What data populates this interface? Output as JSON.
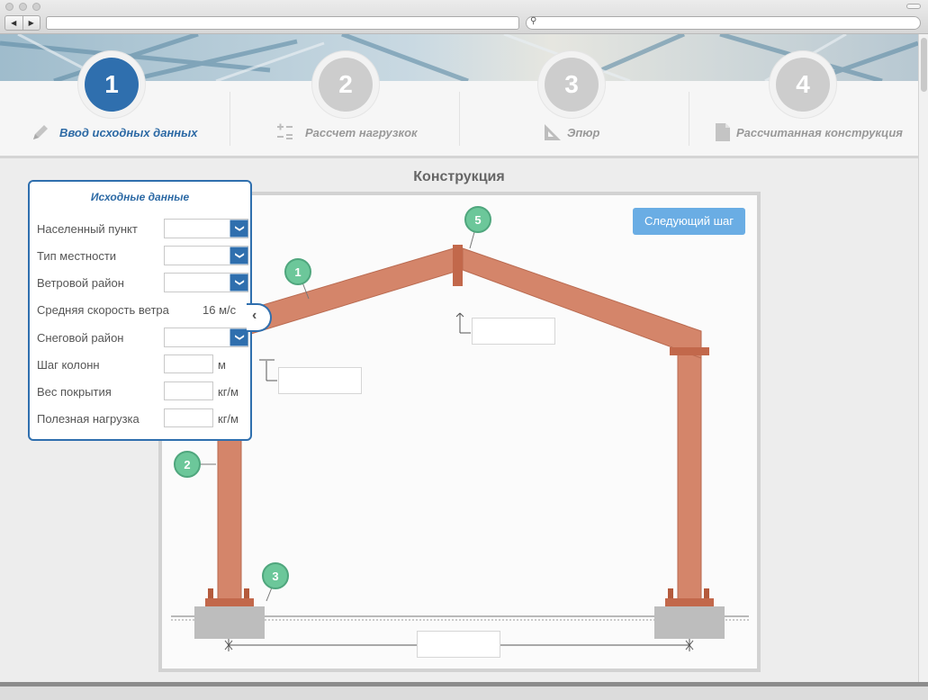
{
  "steps": [
    {
      "number": "1",
      "label": "Ввод исходных данных",
      "icon": "pencil-icon",
      "active": true
    },
    {
      "number": "2",
      "label": "Рассчет нагрузкок",
      "icon": "calculator-icon",
      "active": false
    },
    {
      "number": "3",
      "label": "Эпюр",
      "icon": "ruler-triangle-icon",
      "active": false
    },
    {
      "number": "4",
      "label": "Рассчитанная конструкция",
      "icon": "document-icon",
      "active": false
    }
  ],
  "content": {
    "title": "Конструкция",
    "next_button": "Следующий шаг"
  },
  "form": {
    "title": "Исходные данные",
    "fields": {
      "settlement": "Населенный пункт",
      "terrain": "Тип местности",
      "wind_region": "Ветровой район",
      "wind_speed": "Средняя скорость ветра",
      "wind_speed_value": "16 м/с",
      "snow_region": "Снеговой район",
      "column_step": "Шаг колонн",
      "column_step_unit": "м",
      "cover_weight": "Вес покрытия",
      "cover_weight_unit": "кг/м",
      "payload": "Полезная нагрузка",
      "payload_unit": "кг/м"
    }
  },
  "markers": [
    "1",
    "2",
    "3",
    "5"
  ],
  "colors": {
    "accent": "#2f6fae",
    "steel": "#d4856a",
    "marker": "#6cc79a",
    "button": "#6aade4"
  }
}
